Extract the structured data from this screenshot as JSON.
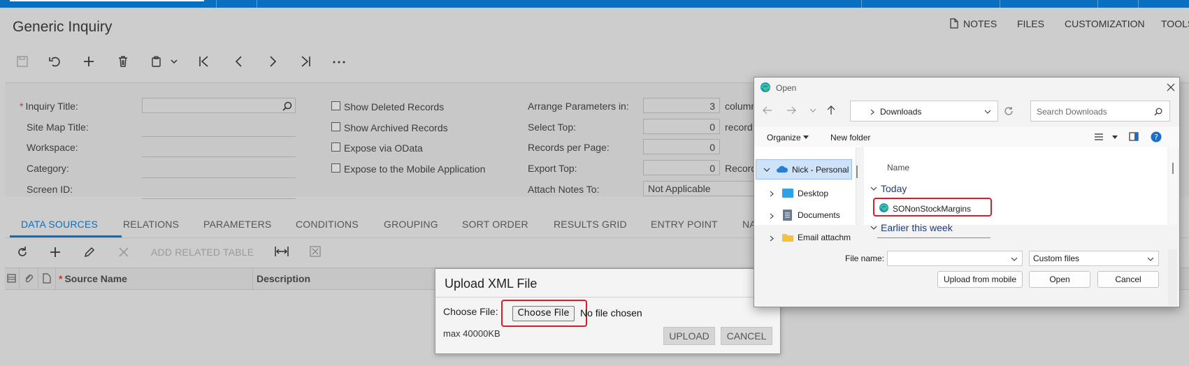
{
  "page": {
    "title": "Generic Inquiry",
    "top_links": [
      "NOTES",
      "FILES",
      "CUSTOMIZATION",
      "TOOLS"
    ]
  },
  "form": {
    "inquiry_title_label": "Inquiry Title:",
    "site_map_title_label": "Site Map Title:",
    "workspace_label": "Workspace:",
    "category_label": "Category:",
    "screen_id_label": "Screen ID:",
    "show_deleted_label": "Show Deleted Records",
    "show_archived_label": "Show Archived Records",
    "expose_odata_label": "Expose via OData",
    "expose_mobile_label": "Expose to the Mobile Application",
    "arrange_params_label": "Arrange Parameters in:",
    "arrange_params_value": "3",
    "arrange_params_unit": "column",
    "select_top_label": "Select Top:",
    "select_top_value": "0",
    "select_top_unit": "record",
    "records_per_page_label": "Records per Page:",
    "records_per_page_value": "0",
    "export_top_label": "Export Top:",
    "export_top_value": "0",
    "export_top_unit": "Record",
    "attach_notes_label": "Attach Notes To:",
    "attach_notes_value": "Not Applicable"
  },
  "tabs": [
    "DATA SOURCES",
    "RELATIONS",
    "PARAMETERS",
    "CONDITIONS",
    "GROUPING",
    "SORT ORDER",
    "RESULTS GRID",
    "ENTRY POINT",
    "NA"
  ],
  "grid": {
    "add_related_table": "ADD RELATED TABLE",
    "col_source_name": "Source Name",
    "col_description": "Description"
  },
  "upload_dialog": {
    "title": "Upload XML File",
    "choose_label": "Choose File:",
    "choose_button": "Choose File",
    "no_file": "No file chosen",
    "max_size": "max 40000KB",
    "upload_button": "UPLOAD",
    "cancel_button": "CANCEL"
  },
  "open_dialog": {
    "title": "Open",
    "location": "Downloads",
    "search_placeholder": "Search Downloads",
    "organize": "Organize",
    "new_folder": "New folder",
    "tree": [
      "Nick - Personal",
      "Desktop",
      "Documents",
      "Email attachm"
    ],
    "column_name": "Name",
    "group_today": "Today",
    "file_selected": "SONonStockMargins",
    "group_earlier": "Earlier this week",
    "file_name_label": "File name:",
    "file_name_value": "",
    "filter": "Custom files",
    "upload_mobile": "Upload from mobile",
    "open_button": "Open",
    "cancel_button": "Cancel"
  },
  "colors": {
    "accent": "#0a6fbf",
    "highlight": "#d0202e"
  }
}
